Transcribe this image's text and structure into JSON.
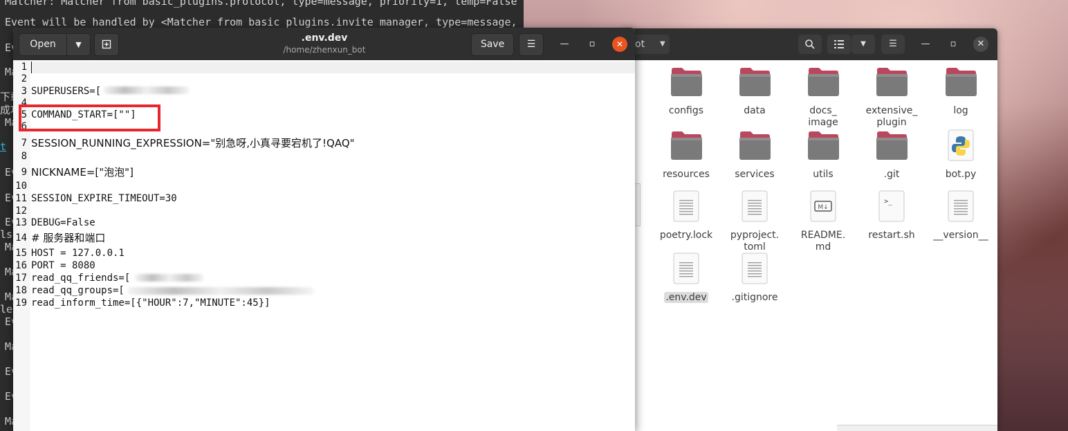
{
  "terminal": {
    "lines": [
      "Matcher: Matcher from basic_plugins.protocol, type=message, priority=1, temp=False",
      "Event will be handled by <Matcher from basic_plugins.invite_manager, type=message,",
      "Ev",
      "Ma",
      "下载",
      "成功",
      "Ma",
      "t",
      "Ev",
      "Ev",
      "Ev",
      "ls",
      "Ma",
      "Ma",
      "Ma",
      "le",
      "Ev",
      "Ma",
      "Ev",
      "Ev",
      "Ma"
    ]
  },
  "files": {
    "header": {
      "path_label": "ot",
      "search_icon": "search-icon",
      "view_icon": "list-view-icon",
      "menu_icon": "hamburger-icon"
    },
    "items": [
      {
        "name": "configs",
        "type": "folder"
      },
      {
        "name": "data",
        "type": "folder"
      },
      {
        "name": "docs_\nimage",
        "type": "folder"
      },
      {
        "name": "extensive_\nplugin",
        "type": "folder"
      },
      {
        "name": "log",
        "type": "folder"
      },
      {
        "name": "resources",
        "type": "folder"
      },
      {
        "name": "services",
        "type": "folder"
      },
      {
        "name": "utils",
        "type": "folder"
      },
      {
        "name": ".git",
        "type": "folder"
      },
      {
        "name": "bot.py",
        "type": "python"
      },
      {
        "name": "poetry.lock",
        "type": "text"
      },
      {
        "name": "pyproject.\ntoml",
        "type": "text"
      },
      {
        "name": "README.\nmd",
        "type": "markdown"
      },
      {
        "name": "restart.sh",
        "type": "script"
      },
      {
        "name": "__version__",
        "type": "text"
      },
      {
        "name": ".env.dev",
        "type": "text",
        "selected": true
      },
      {
        "name": ".gitignore",
        "type": "text"
      }
    ],
    "partial_label": "g"
  },
  "gedit": {
    "open_label": "Open",
    "save_label": "Save",
    "title": ".env.dev",
    "subtitle": "/home/zhenxun_bot",
    "lines": [
      {
        "n": "1",
        "text": ""
      },
      {
        "n": "2",
        "text": ""
      },
      {
        "n": "3",
        "text": "SUPERUSERS=["
      },
      {
        "n": "4",
        "text": ""
      },
      {
        "n": "5",
        "text": "COMMAND_START=[\"\"]"
      },
      {
        "n": "6",
        "text": ""
      },
      {
        "n": "7",
        "text": "SESSION_RUNNING_EXPRESSION=\"别急呀,小真寻要宕机了!QAQ\""
      },
      {
        "n": "8",
        "text": ""
      },
      {
        "n": "9",
        "text": "NICKNAME=[\"泡泡\"]"
      },
      {
        "n": "10",
        "text": ""
      },
      {
        "n": "11",
        "text": "SESSION_EXPIRE_TIMEOUT=30"
      },
      {
        "n": "12",
        "text": ""
      },
      {
        "n": "13",
        "text": "DEBUG=False"
      },
      {
        "n": "14",
        "text": "# 服务器和端口"
      },
      {
        "n": "15",
        "text": "HOST = 127.0.0.1"
      },
      {
        "n": "16",
        "text": "PORT = 8080"
      },
      {
        "n": "17",
        "text": "read_qq_friends=["
      },
      {
        "n": "18",
        "text": "read_qq_groups=["
      },
      {
        "n": "19",
        "text": "read_inform_time=[{\"HOUR\":7,\"MINUTE\":45}]"
      }
    ]
  },
  "colors": {
    "accent": "#e95420",
    "highlight_box": "#e8262c",
    "folder_top": "#b9485f",
    "folder_body": "#7a7a7a"
  }
}
